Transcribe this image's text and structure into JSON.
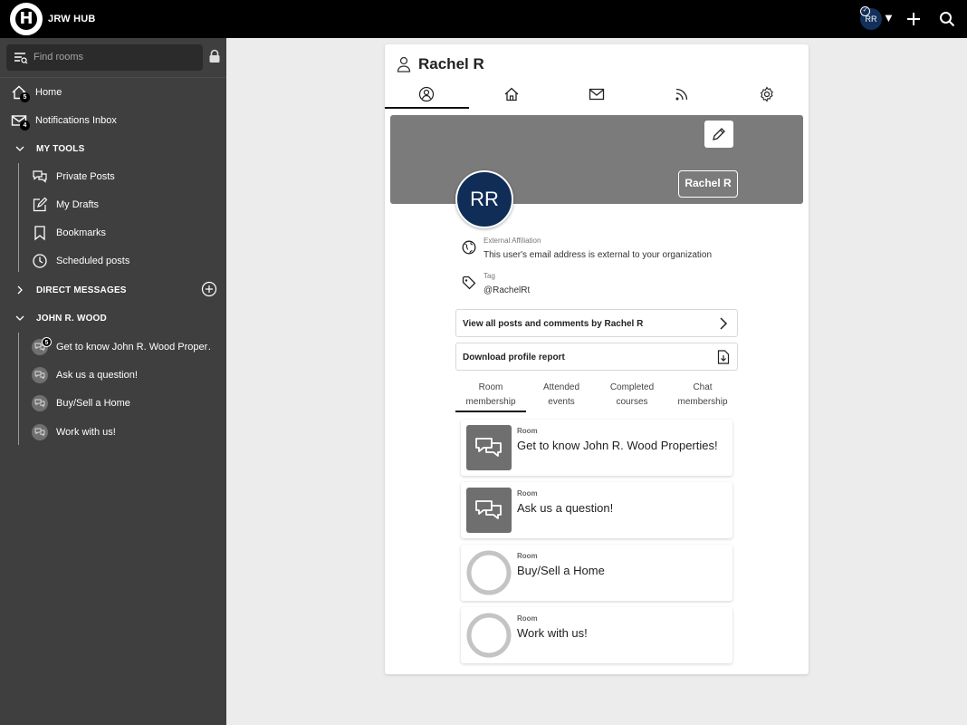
{
  "app": {
    "title": "JRW HUB",
    "logo_letter": "H"
  },
  "topbar": {
    "avatar_initials": "RR",
    "caret": "▼"
  },
  "sidebar": {
    "search_placeholder": "Find rooms",
    "home": {
      "label": "Home",
      "badge": "5"
    },
    "notifications": {
      "label": "Notifications Inbox",
      "badge": "4"
    },
    "my_tools": {
      "label": "MY TOOLS",
      "items": [
        {
          "label": "Private Posts"
        },
        {
          "label": "My Drafts"
        },
        {
          "label": "Bookmarks"
        },
        {
          "label": "Scheduled posts"
        }
      ]
    },
    "direct_messages": {
      "label": "DIRECT MESSAGES"
    },
    "john_wood": {
      "label": "JOHN R. WOOD",
      "items": [
        {
          "label": "Get to know John R. Wood Proper…",
          "badge": "5"
        },
        {
          "label": "Ask us a question!"
        },
        {
          "label": "Buy/Sell a Home"
        },
        {
          "label": "Work with us!"
        }
      ]
    }
  },
  "profile": {
    "name": "Rachel R",
    "initials": "RR",
    "name_chip": "Rachel R",
    "affiliation_label": "External Affiliation",
    "affiliation_value": "This user's email address is external to your organization",
    "tag_label": "Tag",
    "tag_value": "@RachelRt",
    "view_posts": "View all posts and comments by Rachel R",
    "download_report": "Download profile report",
    "sub_tabs": [
      {
        "line1": "Room",
        "line2": "membership"
      },
      {
        "line1": "Attended",
        "line2": "events"
      },
      {
        "line1": "Completed",
        "line2": "courses"
      },
      {
        "line1": "Chat",
        "line2": "membership"
      }
    ],
    "rooms": [
      {
        "type": "Room",
        "name": "Get to know John R. Wood Properties!"
      },
      {
        "type": "Room",
        "name": "Ask us a question!"
      },
      {
        "type": "Room",
        "name": "Buy/Sell a Home"
      },
      {
        "type": "Room",
        "name": "Work with us!"
      }
    ]
  },
  "colors": {
    "topbar": "#000000",
    "sidebar": "#3f3f3f",
    "avatar": "#0f2d57",
    "cover": "#7b7b7b"
  }
}
